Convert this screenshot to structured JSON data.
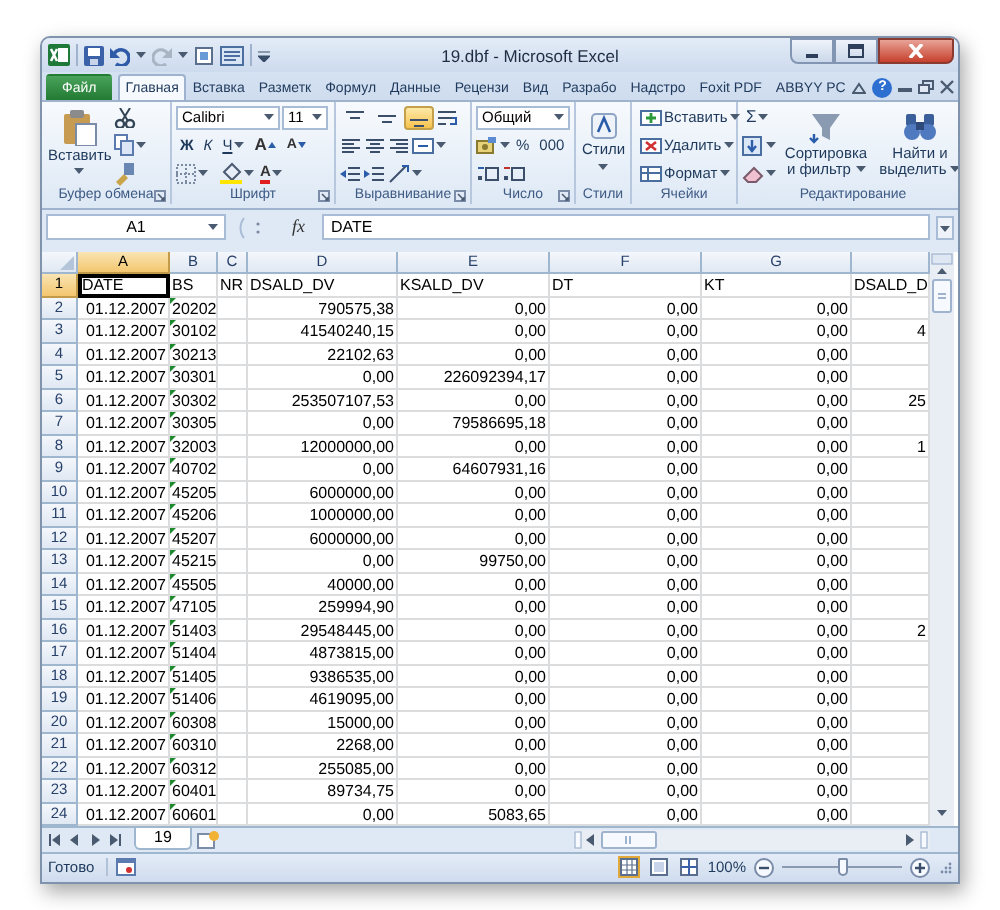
{
  "window": {
    "title": "19.dbf  -  Microsoft Excel"
  },
  "ribbon_tabs": [
    {
      "label": "Файл",
      "kind": "file",
      "selected": false
    },
    {
      "label": "Главная",
      "kind": "tab",
      "selected": true
    },
    {
      "label": "Вставка",
      "kind": "tab",
      "selected": false
    },
    {
      "label": "Разметк",
      "kind": "tab",
      "selected": false
    },
    {
      "label": "Формул",
      "kind": "tab",
      "selected": false
    },
    {
      "label": "Данные",
      "kind": "tab",
      "selected": false
    },
    {
      "label": "Рецензи",
      "kind": "tab",
      "selected": false
    },
    {
      "label": "Вид",
      "kind": "tab",
      "selected": false
    },
    {
      "label": "Разрабо",
      "kind": "tab",
      "selected": false
    },
    {
      "label": "Надстро",
      "kind": "tab",
      "selected": false
    },
    {
      "label": "Foxit PDF",
      "kind": "tab",
      "selected": false
    },
    {
      "label": "ABBYY PC",
      "kind": "tab",
      "selected": false
    }
  ],
  "help_button": "?",
  "clipboard": {
    "label": "Буфер обмена",
    "paste": "Вставить"
  },
  "font": {
    "label": "Шрифт",
    "name": "Calibri",
    "size": "11",
    "bold": "Ж",
    "italic": "К",
    "underline": "Ч",
    "grow": "A",
    "shrink": "A",
    "font_color_letter": "A"
  },
  "alignment": {
    "label": "Выравнивание",
    "vertical": [
      {
        "selected": false
      },
      {
        "selected": false
      },
      {
        "selected": true
      }
    ]
  },
  "number": {
    "label": "Число",
    "format": "Общий",
    "percent": "%",
    "thousands": "000"
  },
  "styles": {
    "label": "Стили",
    "button": "Стили"
  },
  "cells": {
    "label": "Ячейки",
    "buttons": [
      "Вставить",
      "Удалить",
      "Формат"
    ]
  },
  "editing": {
    "label": "Редактирование",
    "sum": "Σ",
    "sort": "Сортировка и фильтр",
    "find": "Найти и выделить"
  },
  "formula_bar": {
    "name_box": "A1",
    "function_label": "fx",
    "formula": "DATE"
  },
  "grid": {
    "columns": [
      {
        "label": "A",
        "selected": true
      },
      {
        "label": "B",
        "selected": false
      },
      {
        "label": "C",
        "selected": false
      },
      {
        "label": "D",
        "selected": false
      },
      {
        "label": "E",
        "selected": false
      },
      {
        "label": "F",
        "selected": false
      },
      {
        "label": "G",
        "selected": false
      },
      {
        "selected": false
      }
    ],
    "rows": [
      {
        "header": "1",
        "kind": "text",
        "selected": true,
        "text_number_flag": false,
        "cells": {
          "A": "DATE",
          "B": "BS",
          "C": "NR",
          "D": "DSALD_DV",
          "E": "KSALD_DV",
          "F": "DT",
          "G": "KT",
          "column_8": "DSALD_D"
        }
      },
      {
        "header": "2",
        "kind": "data",
        "selected": false,
        "text_number_flag": true,
        "cells": {
          "A": "01.12.2007",
          "B": "20202",
          "D": "790575,38",
          "E": "0,00",
          "F": "0,00",
          "G": "0,00"
        }
      },
      {
        "header": "3",
        "kind": "data",
        "selected": false,
        "text_number_flag": true,
        "cells": {
          "A": "01.12.2007",
          "B": "30102",
          "D": "41540240,15",
          "E": "0,00",
          "F": "0,00",
          "G": "0,00",
          "column_8": "4"
        }
      },
      {
        "header": "4",
        "kind": "data",
        "selected": false,
        "text_number_flag": true,
        "cells": {
          "A": "01.12.2007",
          "B": "30213",
          "D": "22102,63",
          "E": "0,00",
          "F": "0,00",
          "G": "0,00"
        }
      },
      {
        "header": "5",
        "kind": "data",
        "selected": false,
        "text_number_flag": true,
        "cells": {
          "A": "01.12.2007",
          "B": "30301",
          "D": "0,00",
          "E": "226092394,17",
          "F": "0,00",
          "G": "0,00"
        }
      },
      {
        "header": "6",
        "kind": "data",
        "selected": false,
        "text_number_flag": true,
        "cells": {
          "A": "01.12.2007",
          "B": "30302",
          "D": "253507107,53",
          "E": "0,00",
          "F": "0,00",
          "G": "0,00",
          "column_8": "25"
        }
      },
      {
        "header": "7",
        "kind": "data",
        "selected": false,
        "text_number_flag": true,
        "cells": {
          "A": "01.12.2007",
          "B": "30305",
          "D": "0,00",
          "E": "79586695,18",
          "F": "0,00",
          "G": "0,00"
        }
      },
      {
        "header": "8",
        "kind": "data",
        "selected": false,
        "text_number_flag": true,
        "cells": {
          "A": "01.12.2007",
          "B": "32003",
          "D": "12000000,00",
          "E": "0,00",
          "F": "0,00",
          "G": "0,00",
          "column_8": "1"
        }
      },
      {
        "header": "9",
        "kind": "data",
        "selected": false,
        "text_number_flag": true,
        "cells": {
          "A": "01.12.2007",
          "B": "40702",
          "D": "0,00",
          "E": "64607931,16",
          "F": "0,00",
          "G": "0,00"
        }
      },
      {
        "header": "10",
        "kind": "data",
        "selected": false,
        "text_number_flag": true,
        "cells": {
          "A": "01.12.2007",
          "B": "45205",
          "D": "6000000,00",
          "E": "0,00",
          "F": "0,00",
          "G": "0,00"
        }
      },
      {
        "header": "11",
        "kind": "data",
        "selected": false,
        "text_number_flag": true,
        "cells": {
          "A": "01.12.2007",
          "B": "45206",
          "D": "1000000,00",
          "E": "0,00",
          "F": "0,00",
          "G": "0,00"
        }
      },
      {
        "header": "12",
        "kind": "data",
        "selected": false,
        "text_number_flag": true,
        "cells": {
          "A": "01.12.2007",
          "B": "45207",
          "D": "6000000,00",
          "E": "0,00",
          "F": "0,00",
          "G": "0,00"
        }
      },
      {
        "header": "13",
        "kind": "data",
        "selected": false,
        "text_number_flag": true,
        "cells": {
          "A": "01.12.2007",
          "B": "45215",
          "D": "0,00",
          "E": "99750,00",
          "F": "0,00",
          "G": "0,00"
        }
      },
      {
        "header": "14",
        "kind": "data",
        "selected": false,
        "text_number_flag": true,
        "cells": {
          "A": "01.12.2007",
          "B": "45505",
          "D": "40000,00",
          "E": "0,00",
          "F": "0,00",
          "G": "0,00"
        }
      },
      {
        "header": "15",
        "kind": "data",
        "selected": false,
        "text_number_flag": true,
        "cells": {
          "A": "01.12.2007",
          "B": "47105",
          "D": "259994,90",
          "E": "0,00",
          "F": "0,00",
          "G": "0,00"
        }
      },
      {
        "header": "16",
        "kind": "data",
        "selected": false,
        "text_number_flag": true,
        "cells": {
          "A": "01.12.2007",
          "B": "51403",
          "D": "29548445,00",
          "E": "0,00",
          "F": "0,00",
          "G": "0,00",
          "column_8": "2"
        }
      },
      {
        "header": "17",
        "kind": "data",
        "selected": false,
        "text_number_flag": true,
        "cells": {
          "A": "01.12.2007",
          "B": "51404",
          "D": "4873815,00",
          "E": "0,00",
          "F": "0,00",
          "G": "0,00"
        }
      },
      {
        "header": "18",
        "kind": "data",
        "selected": false,
        "text_number_flag": true,
        "cells": {
          "A": "01.12.2007",
          "B": "51405",
          "D": "9386535,00",
          "E": "0,00",
          "F": "0,00",
          "G": "0,00"
        }
      },
      {
        "header": "19",
        "kind": "data",
        "selected": false,
        "text_number_flag": true,
        "cells": {
          "A": "01.12.2007",
          "B": "51406",
          "D": "4619095,00",
          "E": "0,00",
          "F": "0,00",
          "G": "0,00"
        }
      },
      {
        "header": "20",
        "kind": "data",
        "selected": false,
        "text_number_flag": true,
        "cells": {
          "A": "01.12.2007",
          "B": "60308",
          "D": "15000,00",
          "E": "0,00",
          "F": "0,00",
          "G": "0,00"
        }
      },
      {
        "header": "21",
        "kind": "data",
        "selected": false,
        "text_number_flag": true,
        "cells": {
          "A": "01.12.2007",
          "B": "60310",
          "D": "2268,00",
          "E": "0,00",
          "F": "0,00",
          "G": "0,00"
        }
      },
      {
        "header": "22",
        "kind": "data",
        "selected": false,
        "text_number_flag": true,
        "cells": {
          "A": "01.12.2007",
          "B": "60312",
          "D": "255085,00",
          "E": "0,00",
          "F": "0,00",
          "G": "0,00"
        }
      },
      {
        "header": "23",
        "kind": "data",
        "selected": false,
        "text_number_flag": true,
        "cells": {
          "A": "01.12.2007",
          "B": "60401",
          "D": "89734,75",
          "E": "0,00",
          "F": "0,00",
          "G": "0,00"
        }
      },
      {
        "header": "24",
        "kind": "data",
        "selected": false,
        "text_number_flag": true,
        "cells": {
          "A": "01.12.2007",
          "B": "60601",
          "D": "0,00",
          "E": "5083,65",
          "F": "0,00",
          "G": "0,00"
        }
      }
    ]
  },
  "sheets": [
    {
      "label": "19",
      "selected": true
    }
  ],
  "status_bar": {
    "status": "Готово",
    "views": [
      {
        "selected": true
      },
      {
        "selected": false
      },
      {
        "selected": false
      }
    ],
    "zoom": {
      "reading": "100%",
      "level": 0.5
    }
  }
}
